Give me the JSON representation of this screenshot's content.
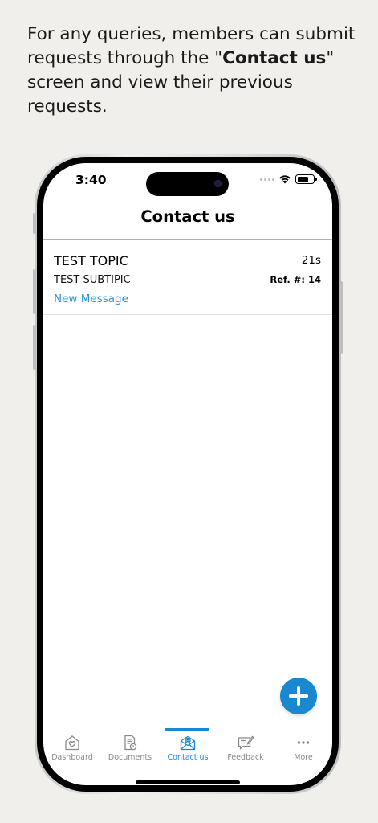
{
  "caption": {
    "before": "For any queries, members can submit requests through the \"",
    "bold": "Contact us",
    "after": "\" screen and view their previous requests."
  },
  "status_bar": {
    "time": "3:40"
  },
  "header": {
    "title": "Contact us"
  },
  "requests": [
    {
      "topic": "TEST TOPIC",
      "time": "21s",
      "subtopic": "TEST SUBTIPIC",
      "ref": "Ref. #: 14",
      "status": "New Message"
    }
  ],
  "fab": {
    "icon": "plus-icon"
  },
  "tabs": [
    {
      "label": "Dashboard",
      "icon": "home-heart-icon",
      "active": false
    },
    {
      "label": "Documents",
      "icon": "document-icon",
      "active": false
    },
    {
      "label": "Contact us",
      "icon": "mail-at-icon",
      "active": true
    },
    {
      "label": "Feedback",
      "icon": "feedback-icon",
      "active": false
    },
    {
      "label": "More",
      "icon": "more-dots-icon",
      "active": false
    }
  ],
  "colors": {
    "accent": "#1a88cf",
    "link": "#2c95d8",
    "tab_inactive": "#8a8a8a",
    "background": "#f0efec"
  }
}
